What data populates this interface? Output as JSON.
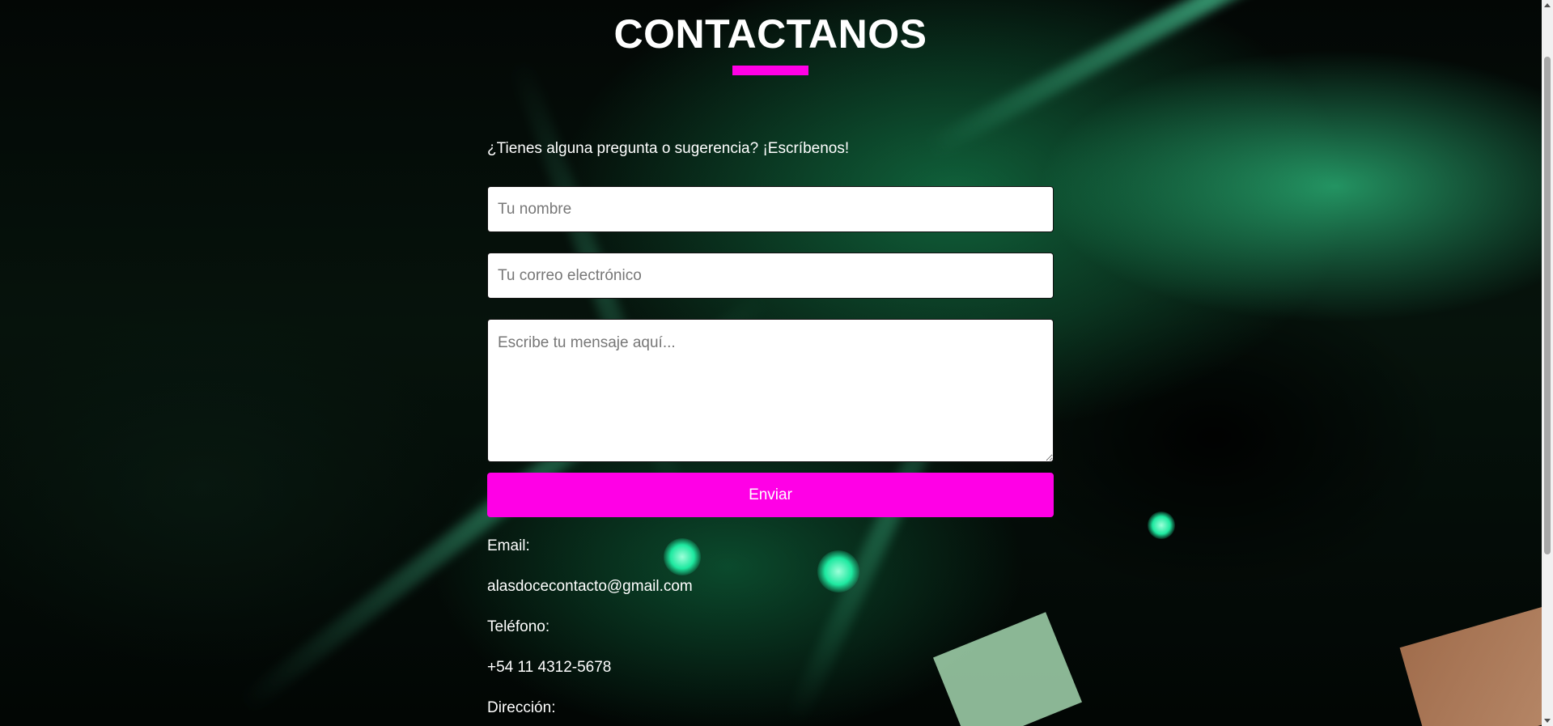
{
  "contact": {
    "title": "CONTACTANOS",
    "subtitle": "¿Tienes alguna pregunta o sugerencia? ¡Escríbenos!",
    "form": {
      "name_placeholder": "Tu nombre",
      "email_placeholder": "Tu correo electrónico",
      "message_placeholder": "Escribe tu mensaje aquí...",
      "submit_label": "Enviar"
    },
    "info": {
      "email_label": "Email:",
      "email_value": "alasdocecontacto@gmail.com",
      "phone_label": "Teléfono:",
      "phone_value": "+54 11 4312-5678",
      "address_label": "Dirección:"
    }
  },
  "colors": {
    "accent": "#ff00e6",
    "text": "#ffffff",
    "background": "#020403"
  }
}
